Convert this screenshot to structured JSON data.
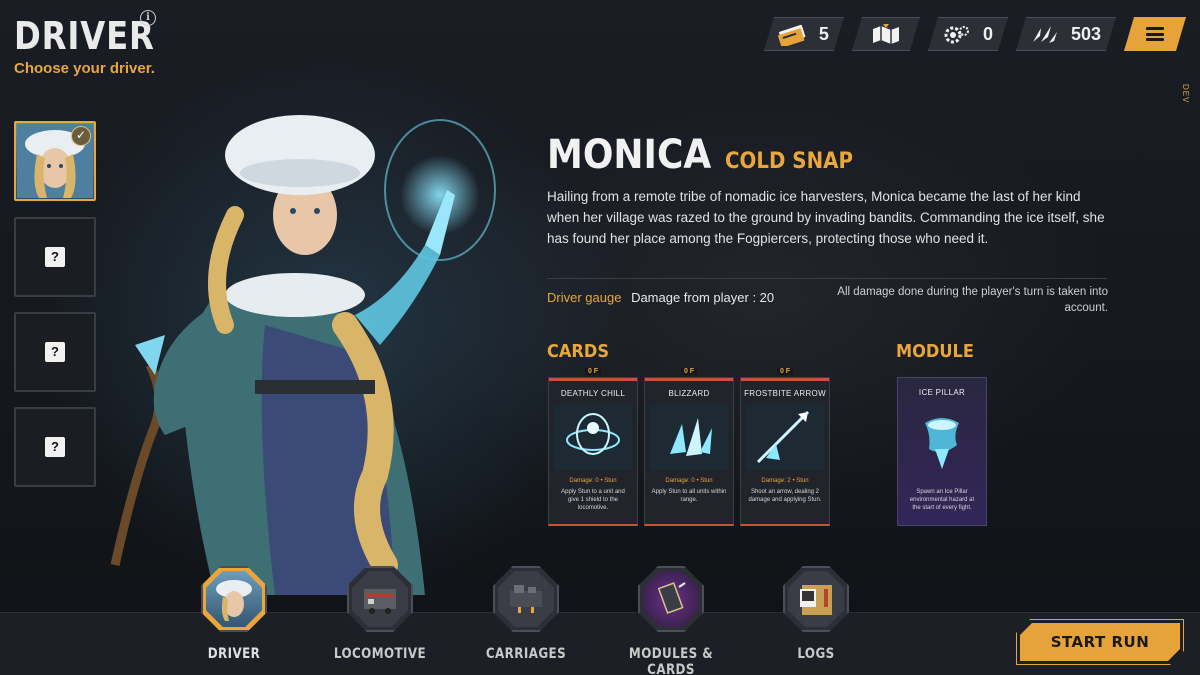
{
  "header": {
    "title": "DRIVER",
    "subtitle": "Choose your driver.",
    "info_glyph": "i"
  },
  "resources": {
    "tickets": {
      "icon": "ticket-icon",
      "value": "5"
    },
    "map": {
      "icon": "map-icon"
    },
    "gears": {
      "icon": "gear-icon",
      "value": "0"
    },
    "shards": {
      "icon": "shard-icon",
      "value": "503"
    },
    "menu": {
      "icon": "menu-icon"
    }
  },
  "dev_label": "DEV",
  "slots": [
    {
      "state": "selected",
      "check": "✓"
    },
    {
      "state": "locked",
      "label": "?"
    },
    {
      "state": "locked",
      "label": "?"
    },
    {
      "state": "locked",
      "label": "?"
    }
  ],
  "driver": {
    "name": "MONICA",
    "epithet": "COLD SNAP",
    "bio": "Hailing from a remote tribe of nomadic ice harvesters, Monica became the last of her kind when her village was razed to the ground by invading bandits. Commanding the ice itself, she has found her place among the Fogpiercers, protecting those who need it.",
    "gauge_label": "Driver gauge",
    "gauge_value": "Damage from player : 20",
    "gauge_note": "All damage done during the player's turn is taken into account."
  },
  "cards_heading": "CARDS",
  "cards": [
    {
      "cost": "0 F",
      "name": "DEATHLY CHILL",
      "stat": "Damage: 0 • Stun",
      "desc": "Apply Stun to a unit and give 1 shield to the locomotive."
    },
    {
      "cost": "0 F",
      "name": "BLIZZARD",
      "stat": "Damage: 0 • Stun",
      "desc": "Apply Stun to all units within range."
    },
    {
      "cost": "0 F",
      "name": "FROSTBITE ARROW",
      "stat": "Damage: 2 • Stun",
      "desc": "Shoot an arrow, dealing 2 damage and applying Stun."
    }
  ],
  "module_heading": "MODULE",
  "module": {
    "name": "ICE PILLAR",
    "desc": "Spawn an Ice Pillar environmental hazard at the start of every fight."
  },
  "nav": [
    {
      "label": "DRIVER",
      "icon": "driver-portrait-icon",
      "active": true
    },
    {
      "label": "LOCOMOTIVE",
      "icon": "locomotive-icon",
      "active": false
    },
    {
      "label": "CARRIAGES",
      "icon": "carriage-icon",
      "active": false
    },
    {
      "label": "MODULES & CARDS",
      "icon": "module-card-icon",
      "active": false
    },
    {
      "label": "LOGS",
      "icon": "logs-folder-icon",
      "active": false
    }
  ],
  "start_label": "START RUN",
  "colors": {
    "accent": "#e9a63c",
    "card_border": "#c9523b",
    "ice": "#7fd6ee"
  }
}
